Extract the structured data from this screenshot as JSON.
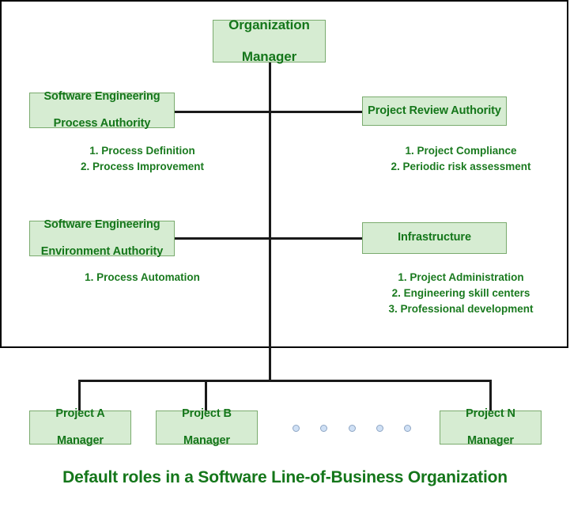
{
  "diagram": {
    "caption": "Default roles in a Software Line-of-Business Organization",
    "root": {
      "line1": "Organization",
      "line2": "Manager"
    },
    "staff": [
      {
        "id": "sepa",
        "line1": "Software Engineering",
        "line2": "Process Authority",
        "bullets": [
          "1. Process Definition",
          "2. Process Improvement"
        ]
      },
      {
        "id": "pra",
        "line1": "Project Review Authority",
        "line2": "",
        "bullets": [
          "1. Project Compliance",
          "2. Periodic risk assessment"
        ]
      },
      {
        "id": "seea",
        "line1": "Software Engineering",
        "line2": "Environment Authority",
        "bullets": [
          "1. Process Automation"
        ]
      },
      {
        "id": "infrastructure",
        "line1": "Infrastructure",
        "line2": "",
        "bullets": [
          "1. Project Administration",
          "2. Engineering skill centers",
          "3. Professional development"
        ]
      }
    ],
    "projects": [
      {
        "id": "project-a",
        "line1": "Project A",
        "line2": "Manager"
      },
      {
        "id": "project-b",
        "line1": "Project B",
        "line2": "Manager"
      },
      {
        "id": "project-n",
        "line1": "Project N",
        "line2": "Manager"
      }
    ],
    "ellipsis_dot_count": 5,
    "colors": {
      "box_fill": "#d6ecd2",
      "box_border": "#7aab6e",
      "text_green": "#14761a",
      "line_black": "#1a1a1a",
      "dot_fill": "#cfe0f5",
      "dot_border": "#8fa6c4"
    }
  }
}
